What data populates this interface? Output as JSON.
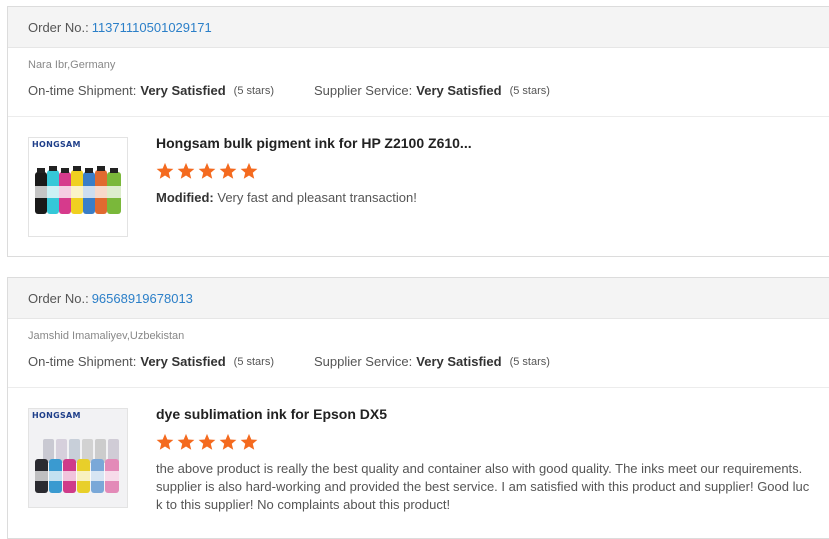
{
  "orders": [
    {
      "order_label": "Order No.:",
      "order_number": "11371110501029171",
      "buyer": "Nara Ibr,Germany",
      "shipment_label": "On-time Shipment:",
      "shipment_value": "Very Satisfied",
      "shipment_stars": "(5 stars)",
      "service_label": "Supplier Service:",
      "service_value": "Very Satisfied",
      "service_stars": "(5 stars)",
      "product_brand": "HONGSAM",
      "product_title": "Hongsam bulk pigment ink for HP Z2100 Z610...",
      "rating": 5,
      "feedback_prefix": "Modified:",
      "feedback_text": " Very fast and pleasant transaction!"
    },
    {
      "order_label": "Order No.:",
      "order_number": "96568919678013",
      "buyer": "Jamshid Imamaliyev,Uzbekistan",
      "shipment_label": "On-time Shipment:",
      "shipment_value": "Very Satisfied",
      "shipment_stars": "(5 stars)",
      "service_label": "Supplier Service:",
      "service_value": "Very Satisfied",
      "service_stars": "(5 stars)",
      "product_brand": "HONGSAM",
      "product_title": "dye sublimation ink for Epson DX5",
      "rating": 5,
      "feedback_text": "the above product is really the best quality and container also with good quality. The inks meet our requirements. supplier is also hard-working and provided the best service. I am satisfied with this product and supplier! Good luck to this supplier! No complaints about this product!"
    }
  ],
  "colors": {
    "link": "#2b7fc8",
    "star": "#f46a1f",
    "header_bg": "#f4f4f4"
  }
}
